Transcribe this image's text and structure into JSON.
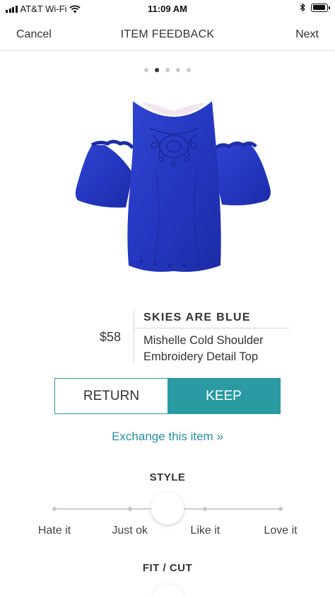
{
  "status_bar": {
    "carrier": "AT&T Wi-Fi",
    "time": "11:09 AM",
    "wifi_icon": "wifi-icon",
    "bluetooth_icon": "bluetooth-icon",
    "battery_icon": "battery-icon",
    "battery_level": 0.9
  },
  "nav": {
    "cancel_label": "Cancel",
    "title": "ITEM FEEDBACK",
    "next_label": "Next"
  },
  "pager": {
    "count": 5,
    "active_index": 1
  },
  "product": {
    "image_icon": "blouse-image",
    "image_color": "#2436c0",
    "price": "$58",
    "brand": "SKIES ARE BLUE",
    "name": "Mishelle Cold Shoulder Embroidery Detail Top"
  },
  "decision": {
    "return_label": "RETURN",
    "keep_label": "KEEP",
    "selected": "KEEP"
  },
  "exchange_label": "Exchange this item »",
  "style": {
    "title": "STYLE",
    "options": [
      "Hate it",
      "Just ok",
      "Like it",
      "Love it"
    ],
    "value": 1.5
  },
  "fit": {
    "title": "FIT / CUT"
  },
  "colors": {
    "accent": "#2a9aa3",
    "link": "#2a8ea3",
    "text": "#333333"
  }
}
